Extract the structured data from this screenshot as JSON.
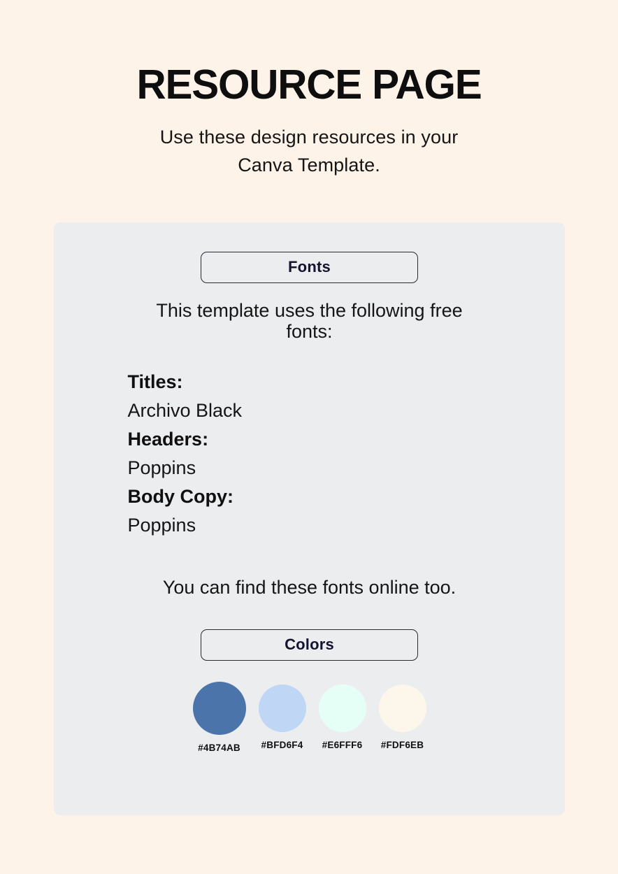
{
  "header": {
    "title": "RESOURCE PAGE",
    "subtitle": "Use these design resources in your Canva Template."
  },
  "card": {
    "fonts_section": {
      "pill_label": "Fonts",
      "intro_text": "This template uses the following free fonts:",
      "font_rows": [
        {
          "label": "Titles:",
          "value": "Archivo Black"
        },
        {
          "label": "Headers:",
          "value": "Poppins"
        },
        {
          "label": "Body Copy:",
          "value": "Poppins"
        }
      ],
      "online_note": "You can find these fonts online too."
    },
    "colors_section": {
      "pill_label": "Colors",
      "swatches": [
        {
          "hex": "#4B74AB",
          "label": "#4B74AB",
          "size": "lg"
        },
        {
          "hex": "#BFD6F4",
          "label": "#BFD6F4",
          "size": "sm"
        },
        {
          "hex": "#E6FFF6",
          "label": "#E6FFF6",
          "size": "sm"
        },
        {
          "hex": "#FDF6EB",
          "label": "#FDF6EB",
          "size": "sm"
        }
      ]
    }
  },
  "theme": {
    "page_background": "#FDF3E8",
    "card_background": "#ECEDEF",
    "text_color": "#111111",
    "pill_border": "#2A2A33",
    "pill_text": "#141430"
  }
}
